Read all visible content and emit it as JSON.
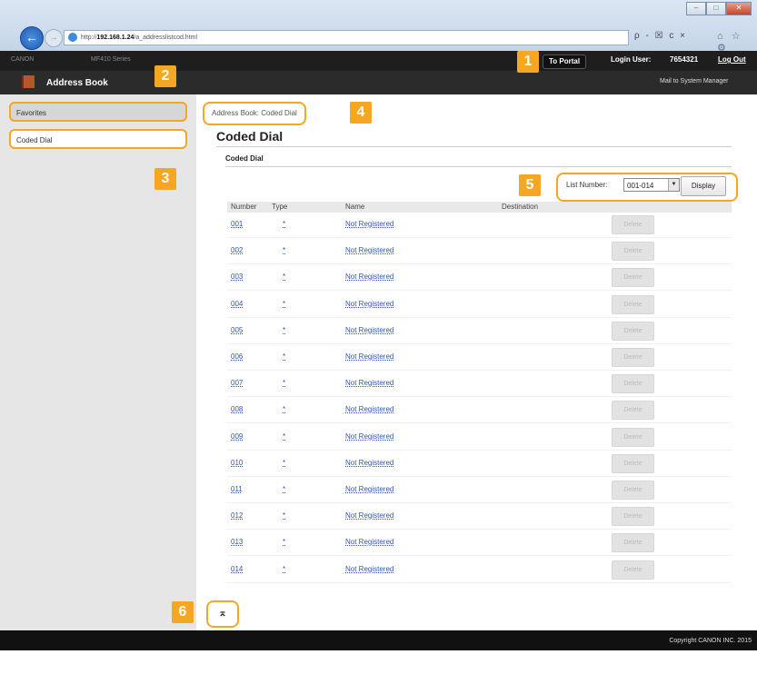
{
  "browser": {
    "url_prefix": "http://",
    "url_host": "192.168.1.24",
    "url_path": "/a_addresslistcod.html",
    "addr_icons": "ρ - ☒ c ×",
    "nav_icons": "⌂ ☆ ⚙"
  },
  "header": {
    "device_id": "CANON",
    "device_model": "MF410 Series",
    "portal_label": "To Portal",
    "login_label": "Login User:",
    "login_user": "7654321",
    "logout_label": "Log Out",
    "app_title": "Address Book",
    "mail_link": "Mail to System Manager"
  },
  "sidebar": {
    "items": [
      {
        "label": "Favorites"
      },
      {
        "label": "Coded Dial"
      }
    ]
  },
  "main": {
    "breadcrumb": "Address Book: Coded Dial",
    "page_title": "Coded Dial",
    "section_title": "Coded Dial",
    "list_number_label": "List Number:",
    "list_number_value": "001-014",
    "display_label": "Display",
    "columns": [
      "Number",
      "Type",
      "Name",
      "Destination"
    ],
    "rows": [
      {
        "number": "001",
        "type": "*",
        "name": "Not Registered",
        "action": "Delete"
      },
      {
        "number": "002",
        "type": "*",
        "name": "Not Registered",
        "action": "Delete"
      },
      {
        "number": "003",
        "type": "*",
        "name": "Not Registered",
        "action": "Delete"
      },
      {
        "number": "004",
        "type": "*",
        "name": "Not Registered",
        "action": "Delete"
      },
      {
        "number": "005",
        "type": "*",
        "name": "Not Registered",
        "action": "Delete"
      },
      {
        "number": "006",
        "type": "*",
        "name": "Not Registered",
        "action": "Delete"
      },
      {
        "number": "007",
        "type": "*",
        "name": "Not Registered",
        "action": "Delete"
      },
      {
        "number": "008",
        "type": "*",
        "name": "Not Registered",
        "action": "Delete"
      },
      {
        "number": "009",
        "type": "*",
        "name": "Not Registered",
        "action": "Delete"
      },
      {
        "number": "010",
        "type": "*",
        "name": "Not Registered",
        "action": "Delete"
      },
      {
        "number": "011",
        "type": "*",
        "name": "Not Registered",
        "action": "Delete"
      },
      {
        "number": "012",
        "type": "*",
        "name": "Not Registered",
        "action": "Delete"
      },
      {
        "number": "013",
        "type": "*",
        "name": "Not Registered",
        "action": "Delete"
      },
      {
        "number": "014",
        "type": "*",
        "name": "Not Registered",
        "action": "Delete"
      }
    ],
    "top_button": "⌅"
  },
  "footer": {
    "copyright": "Copyright CANON INC. 2015"
  },
  "callouts": [
    "1",
    "2",
    "3",
    "4",
    "5",
    "6"
  ],
  "colors": {
    "accent": "#f5a623",
    "header_bg": "#2b2b2b",
    "link": "#3355aa"
  }
}
